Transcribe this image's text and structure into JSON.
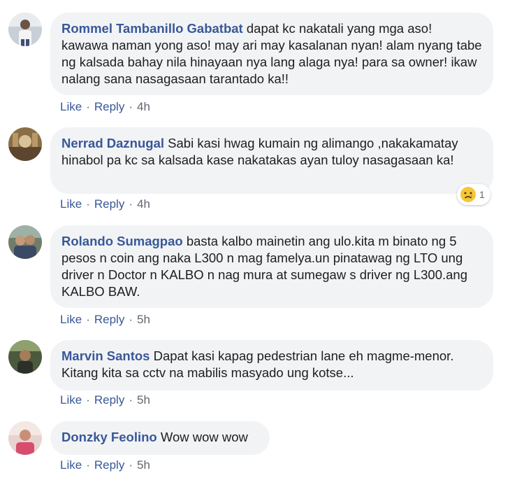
{
  "comments": [
    {
      "author": "Rommel Tambanillo Gabatbat",
      "text": "dapat kc nakatali yang mga aso! kawawa naman yong aso! may ari may kasalanan nyan! alam nyang tabe ng kalsada bahay nila hinayaan nya lang alaga nya! para sa owner! ikaw nalang sana nasagasaan tarantado ka!!",
      "like": "Like",
      "reply": "Reply",
      "time": "4h"
    },
    {
      "author": "Nerrad Daznugal",
      "text": "Sabi kasi hwag kumain ng alimango ,nakakamatay hinabol pa kc sa kalsada kase nakatakas ayan tuloy nasagasaan ka!",
      "like": "Like",
      "reply": "Reply",
      "time": "4h",
      "reaction": {
        "icon": "sad-face-icon",
        "count": "1"
      }
    },
    {
      "author": "Rolando Sumagpao",
      "text": "basta kalbo mainetin ang ulo.kita m binato ng 5 pesos n coin ang naka L300 n mag famelya.un pinatawag ng LTO ung driver n Doctor n KALBO n nag mura at sumegaw s driver ng L300.ang KALBO BAW.",
      "like": "Like",
      "reply": "Reply",
      "time": "5h"
    },
    {
      "author": "Marvin Santos",
      "text": "Dapat kasi kapag pedestrian lane eh magme-menor. Kitang kita sa cctv na mabilis masyado ung kotse...",
      "like": "Like",
      "reply": "Reply",
      "time": "5h"
    },
    {
      "author": "Donzky Feolino",
      "text": "Wow wow wow",
      "like": "Like",
      "reply": "Reply",
      "time": "5h"
    }
  ],
  "separator": "·",
  "colors": {
    "link": "#385898",
    "bubble": "#f2f3f5",
    "meta": "#606770",
    "sad": "#f7c637"
  }
}
